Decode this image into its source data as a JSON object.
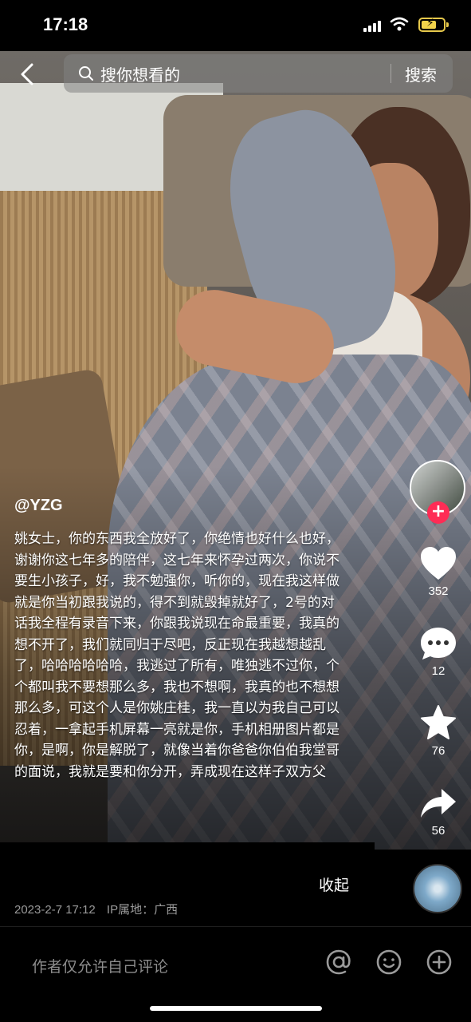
{
  "status_bar": {
    "time": "17:18"
  },
  "search": {
    "placeholder": "搜你想看的",
    "button_label": "搜索"
  },
  "actions": {
    "like_count": "352",
    "comment_count": "12",
    "favorite_count": "76",
    "share_count": "56",
    "follow_symbol": "+"
  },
  "post": {
    "author": "@YZG",
    "caption": "姚女士，你的东西我全放好了，你绝情也好什么也好，谢谢你这七年多的陪伴，这七年来怀孕过两次，你说不要生小孩子，好，我不勉强你，听你的，现在我这样做就是你当初跟我说的，得不到就毁掉就好了，2号的对话我全程有录音下来，你跟我说现在命最重要，我真的想不开了，我们就同归于尽吧，反正现在我越想越乱了，哈哈哈哈哈哈，我逃过了所有，唯独逃不过你，个个都叫我不要想那么多，我也不想啊，我真的也不想想那么多，可这个人是你姚庄桂，我一直以为我自己可以忍着，一拿起手机屏幕一亮就是你，手机相册图片都是你，是啊，你是解脱了，就像当着你爸爸你伯伯我堂哥的面说，我就是要和你分开，弄成现在这样子双方父",
    "collapse_label": "收起",
    "date": "2023-2-7 17:12",
    "ip_location": "IP属地：广西"
  },
  "comment_bar": {
    "placeholder": "作者仅允许自己评论",
    "icons": [
      "at-icon",
      "emoji-icon",
      "add-icon"
    ]
  },
  "colors": {
    "follow_red": "#fe2c55",
    "battery_yellow": "#f2d34b"
  }
}
